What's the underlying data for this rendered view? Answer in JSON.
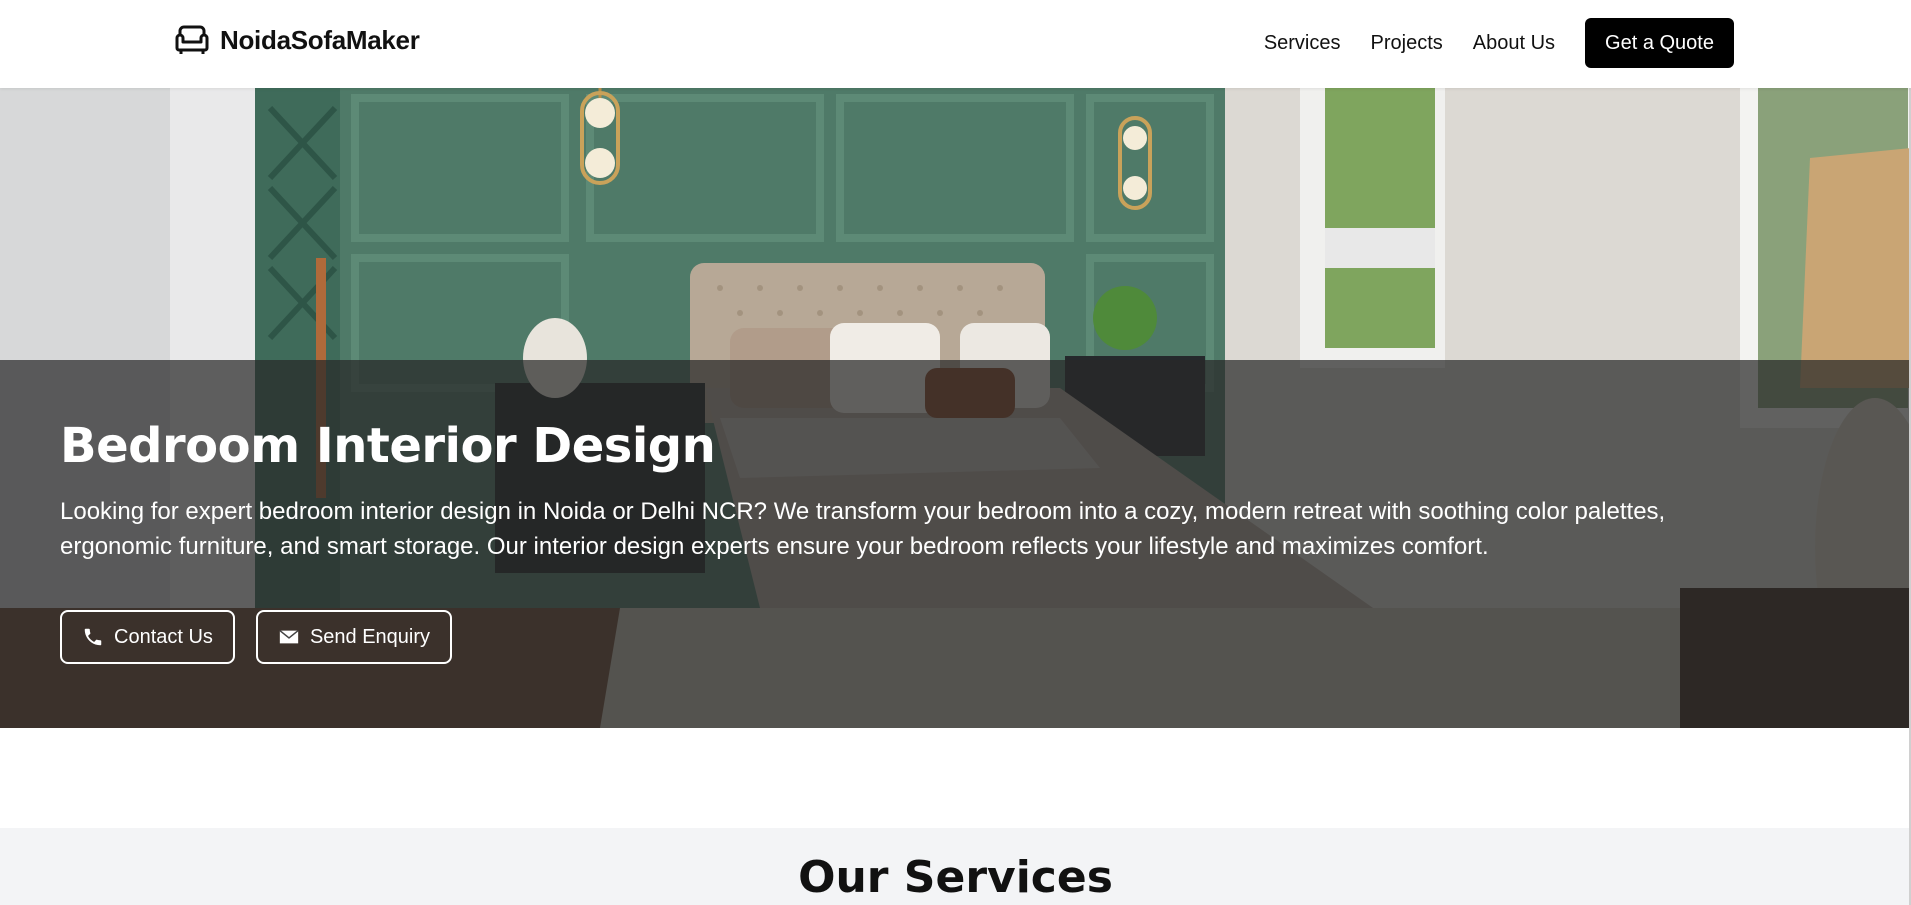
{
  "header": {
    "brand_name": "NoidaSofaMaker",
    "brand_icon": "sofa-icon",
    "nav": [
      {
        "label": "Services"
      },
      {
        "label": "Projects"
      },
      {
        "label": "About Us"
      }
    ],
    "cta_label": "Get a Quote"
  },
  "hero": {
    "title": "Bedroom Interior Design",
    "description": "Looking for expert bedroom interior design in Noida or Delhi NCR? We transform your bedroom into a cozy, modern retreat with soothing color palettes, ergonomic furniture, and smart storage. Our interior design experts ensure your bedroom reflects your lifestyle and maximizes comfort.",
    "buttons": [
      {
        "label": "Contact Us",
        "icon": "phone-icon"
      },
      {
        "label": "Send Enquiry",
        "icon": "envelope-icon"
      }
    ]
  },
  "services": {
    "title": "Our Services"
  },
  "colors": {
    "cta_background": "#000000",
    "overlay": "#282828",
    "section_background": "#f3f4f6",
    "wall_green": "#4f7a68"
  }
}
